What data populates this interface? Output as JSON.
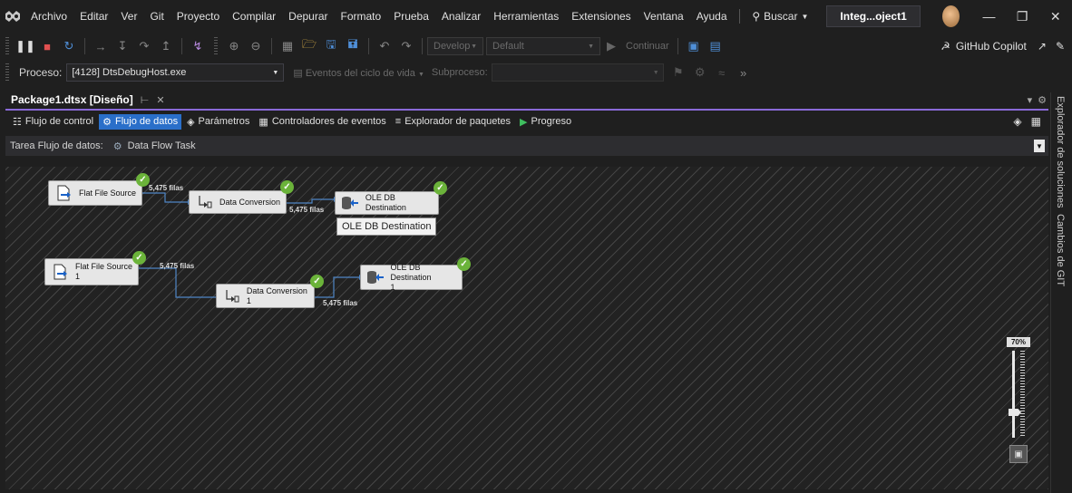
{
  "menu": {
    "items": [
      "Archivo",
      "Editar",
      "Ver",
      "Git",
      "Proyecto",
      "Compilar",
      "Depurar",
      "Formato",
      "Prueba",
      "Analizar",
      "Herramientas",
      "Extensiones",
      "Ventana",
      "Ayuda"
    ],
    "search_label": "Buscar",
    "solution_name": "Integ...oject1"
  },
  "toolbar": {
    "branch_combo": "Develop",
    "config_combo": "Default",
    "continue_label": "Continuar",
    "copilot_label": "GitHub Copilot",
    "process_label": "Proceso:",
    "process_value": "[4128] DtsDebugHost.exe",
    "lifecycle_label": "Eventos del ciclo de vida",
    "subprocess_label": "Subproceso:"
  },
  "document": {
    "tab_title": "Package1.dtsx [Diseño]",
    "designer_tabs": [
      "Flujo de control",
      "Flujo de datos",
      "Parámetros",
      "Controladores de eventos",
      "Explorador de paquetes",
      "Progreso"
    ],
    "task_label": "Tarea Flujo de datos:",
    "task_value": "Data Flow Task"
  },
  "dataflow": {
    "components": {
      "src1": "Flat File Source",
      "conv1": "Data Conversion",
      "dst1": "OLE DB Destination",
      "src2_line1": "Flat File Source",
      "src2_line2": "1",
      "conv2": "Data Conversion 1",
      "dst2_line1": "OLE DB Destination",
      "dst2_line2": "1"
    },
    "row_counts": {
      "a": "5,475 filas",
      "b": "5,475 filas",
      "c": "5,475 filas",
      "d": "5,475 filas"
    },
    "tooltip": "OLE DB Destination",
    "zoom": "70%"
  },
  "side_panel": {
    "tabs": [
      "Explorador de soluciones",
      "Cambios de GIT"
    ]
  },
  "colors": {
    "accent": "#8a6ad8",
    "active_tab": "#2a6fc9",
    "success": "#6bb33a"
  }
}
